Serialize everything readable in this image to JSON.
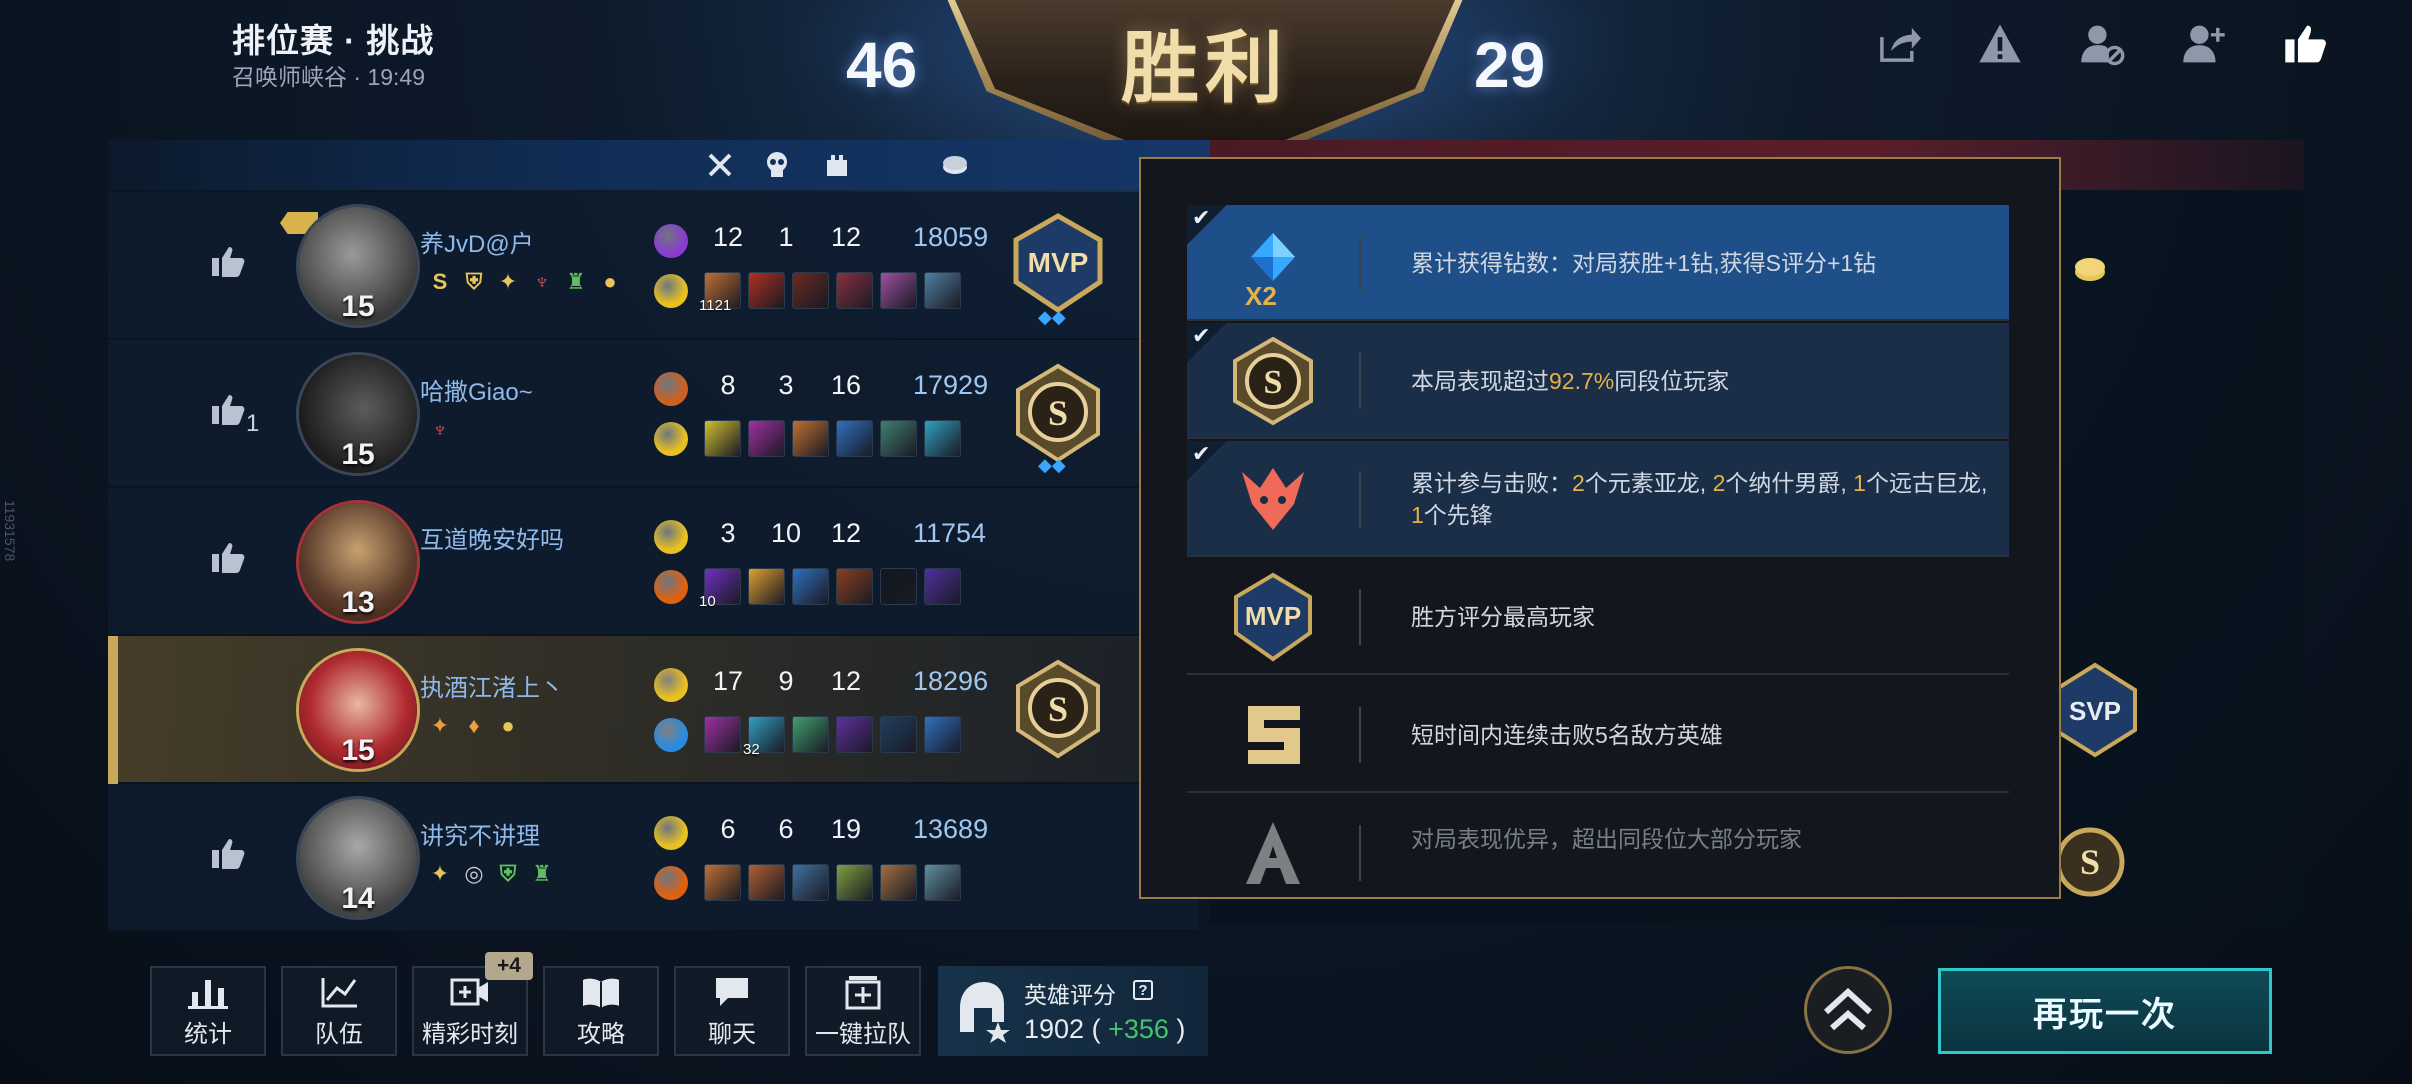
{
  "header": {
    "mode_title": "排位赛 · 挑战",
    "mode_sub": "召唤师峡谷 · 19:49",
    "score_left": "46",
    "score_right": "29",
    "result": "胜利",
    "icons": [
      "share-icon",
      "warning-icon",
      "block-user-icon",
      "add-friend-icon",
      "thumbs-up-icon"
    ]
  },
  "table_headers": [
    "kills-icon",
    "deaths-icon",
    "assists-icon",
    "gold-icon"
  ],
  "players": [
    {
      "name": "养JvD@户",
      "level": "15",
      "likes": "",
      "kills": "12",
      "deaths": "1",
      "assists": "12",
      "gold": "18059",
      "medal": "MVP",
      "tags": [
        "S"
      ],
      "first_item_count": "1121"
    },
    {
      "name": "哈撒Giao~",
      "level": "15",
      "likes": "1",
      "kills": "8",
      "deaths": "3",
      "assists": "16",
      "gold": "17929",
      "medal": "S",
      "tags": []
    },
    {
      "name": "互道晚安好吗",
      "level": "13",
      "likes": "",
      "kills": "3",
      "deaths": "10",
      "assists": "12",
      "gold": "11754",
      "medal": "",
      "tags": [],
      "first_item_count": "10"
    },
    {
      "name": "执酒江渚上丶",
      "level": "15",
      "likes": "",
      "kills": "17",
      "deaths": "9",
      "assists": "12",
      "gold": "18296",
      "medal": "S",
      "tags": [],
      "second_item_count": "32"
    },
    {
      "name": "讲究不讲理",
      "level": "14",
      "likes": "",
      "kills": "6",
      "deaths": "6",
      "assists": "19",
      "gold": "13689",
      "medal": "",
      "tags": []
    }
  ],
  "popup": {
    "rows": [
      {
        "icon": "diamond-icon",
        "badge": "X2",
        "text_plain": "累计获得钻数：对局获胜+1钻,获得S评分+1钻",
        "checked": true
      },
      {
        "icon": "s-rank-icon",
        "text_a": "本局表现超过",
        "text_hl": "92.7%",
        "text_b": "同段位玩家",
        "checked": true
      },
      {
        "icon": "dragon-icon",
        "text_a": "累计参与击败：",
        "n1": "2",
        "t1": "个元素亚龙, ",
        "n2": "2",
        "t2": "个纳什男爵, ",
        "n3": "1",
        "t3": "个远古巨龙, ",
        "n4": "1",
        "t4": "个先锋",
        "checked": true
      },
      {
        "icon": "mvp-icon",
        "text_plain": "胜方评分最高玩家",
        "checked": false
      },
      {
        "icon": "penta-icon",
        "text_plain": "短时间内连续击败5名敌方英雄",
        "checked": false
      },
      {
        "icon": "a-rank-icon",
        "text_plain": "对局表现优异，超出同段位大部分玩家",
        "checked": false
      }
    ]
  },
  "bottom": {
    "buttons": [
      "统计",
      "队伍",
      "精彩时刻",
      "攻略",
      "聊天",
      "一键拉队"
    ],
    "highlights_badge": "+4",
    "rating_title": "英雄评分",
    "rating_q": "?",
    "rating_value": "1902",
    "rating_open": " ( ",
    "rating_gain": "+356",
    "rating_close": " )",
    "play_again": "再玩一次"
  },
  "side_id": "11931578",
  "colors": {
    "accent_gold": "#e4b347",
    "ally_blue": "#8fb9ea",
    "play_again_border": "#2ec8c8",
    "rating_gain": "#43c46b"
  }
}
